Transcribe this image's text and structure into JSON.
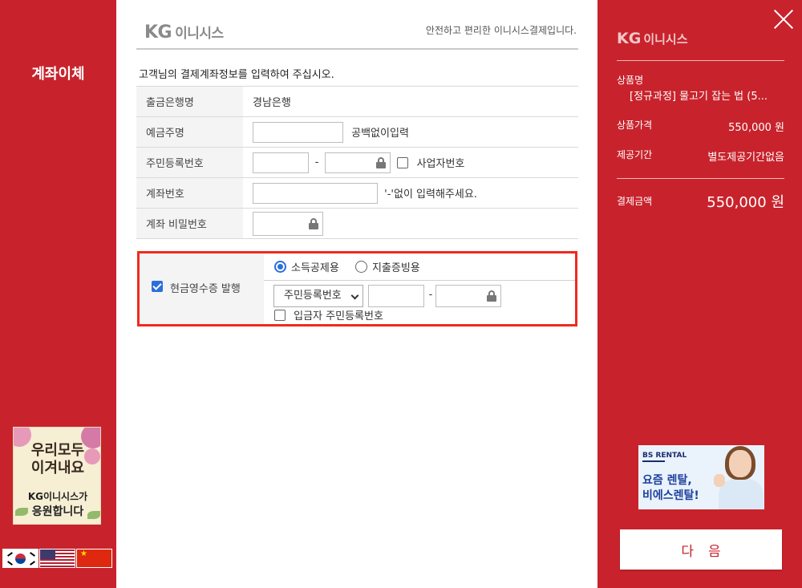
{
  "left": {
    "title": "계좌이체",
    "banner": {
      "line1": "우리모두",
      "line2": "이겨내요",
      "line3": "KG이니시스가",
      "line4": "응원합니다"
    },
    "flags": [
      "korea-flag",
      "usa-flag",
      "china-flag"
    ]
  },
  "header": {
    "logo_kg": "KG",
    "logo_name": "이니시스",
    "tagline": "안전하고 편리한 이니시스결제입니다."
  },
  "instruction": "고객님의 결제계좌정보를 입력하여 주십시오.",
  "form": {
    "bank": {
      "label": "출금은행명",
      "value": "경남은행"
    },
    "depositor": {
      "label": "예금주명",
      "value": "",
      "hint": "공백없이입력"
    },
    "resident": {
      "label": "주민등록번호",
      "dash": "-",
      "business_label": "사업자번호"
    },
    "account": {
      "label": "계좌번호",
      "value": "",
      "hint": "'-'없이 입력해주세요."
    },
    "password": {
      "label": "계좌 비밀번호",
      "value": ""
    }
  },
  "receipt": {
    "label": "현금영수증 발행",
    "checked": true,
    "radio_income": "소득공제용",
    "radio_expense": "지출증빙용",
    "selected_radio": "소득공제용",
    "id_type_selected": "주민등록번호",
    "dash": "-",
    "depositor_id_label": "입금자 주민등록번호"
  },
  "summary": {
    "logo_kg": "KG",
    "logo_name": "이니시스",
    "product_label": "상품명",
    "product_name": "[정규과정] 물고기 잡는 법 (5...",
    "price_label": "상품가격",
    "price_value": "550,000 원",
    "period_label": "제공기간",
    "period_value": "별도제공기간없음",
    "total_label": "결제금액",
    "total_value": "550,000 원"
  },
  "right_banner": {
    "brand": "BS RENTAL",
    "line1": "요즘 렌탈,",
    "line2": "비에스렌탈!"
  },
  "next_button": "다음",
  "colors": {
    "brand_red": "#c8232c",
    "highlight_border": "#f02a1e",
    "check_blue": "#2a6fdb"
  }
}
